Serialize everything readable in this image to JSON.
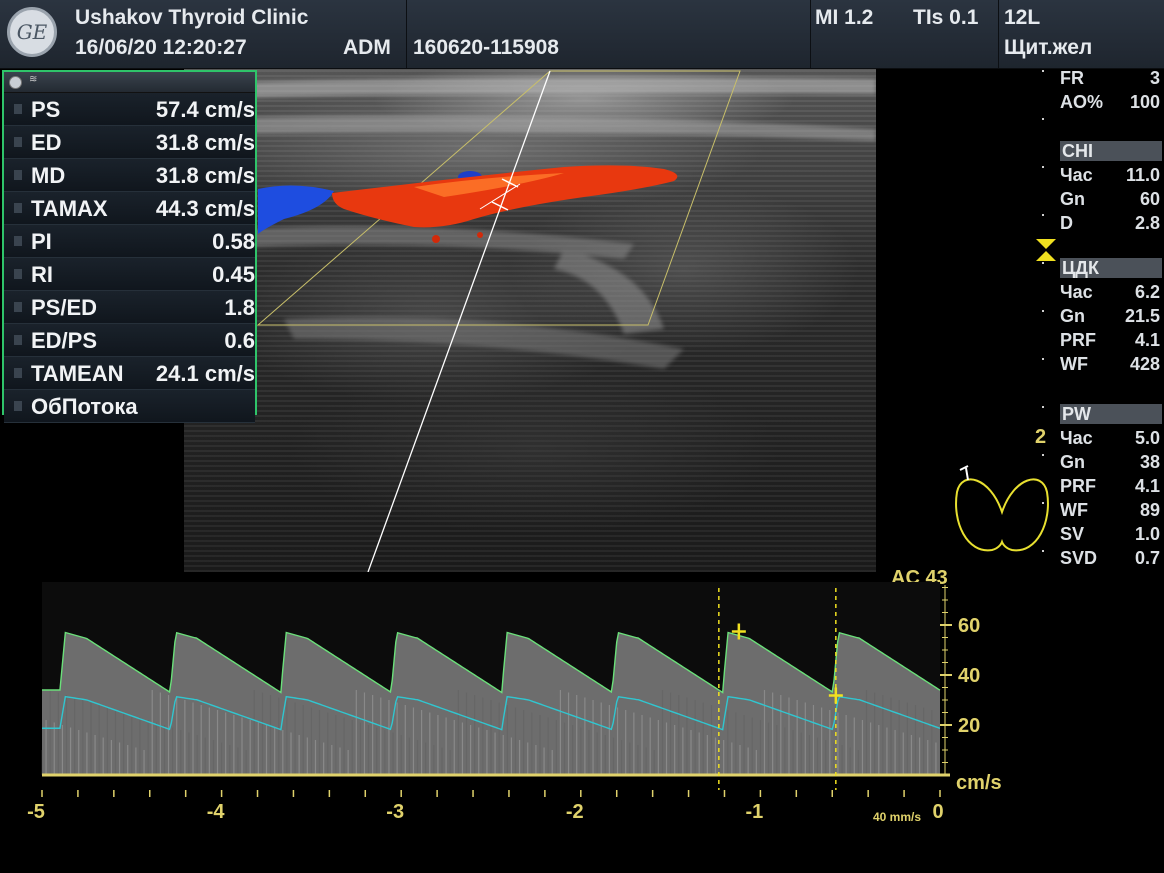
{
  "header": {
    "clinic": "Ushakov Thyroid Clinic",
    "datetime": "16/06/20 12:20:27",
    "operator": "ADM",
    "exam_id": "160620-115908",
    "mi": "MI 1.2",
    "tis": "TIs 0.1",
    "probe": "12L",
    "preset": "Щит.жел",
    "logo_text": "GE"
  },
  "measurements": [
    {
      "label": "PS",
      "value": "57.4 cm/s"
    },
    {
      "label": "ED",
      "value": "31.8 cm/s"
    },
    {
      "label": "MD",
      "value": "31.8 cm/s"
    },
    {
      "label": "TAMAX",
      "value": "44.3 cm/s"
    },
    {
      "label": "PI",
      "value": "0.58"
    },
    {
      "label": "RI",
      "value": "0.45"
    },
    {
      "label": "PS/ED",
      "value": "1.8"
    },
    {
      "label": "ED/PS",
      "value": "0.6"
    },
    {
      "label": "TAMEAN",
      "value": "24.1 cm/s"
    },
    {
      "label": "ОбПотока",
      "value": ""
    }
  ],
  "params": {
    "top": [
      {
        "k": "FR",
        "v": "3"
      },
      {
        "k": "AO%",
        "v": "100"
      }
    ],
    "chi": {
      "title": "CHI",
      "rows": [
        {
          "k": "Час",
          "v": "11.0"
        },
        {
          "k": "Gn",
          "v": "60"
        },
        {
          "k": "D",
          "v": "2.8"
        }
      ]
    },
    "cdk": {
      "title": "ЦДК",
      "rows": [
        {
          "k": "Час",
          "v": "6.2"
        },
        {
          "k": "Gn",
          "v": "21.5"
        },
        {
          "k": "PRF",
          "v": "4.1"
        },
        {
          "k": "WF",
          "v": "428"
        }
      ]
    },
    "pw": {
      "title": "PW",
      "rows": [
        {
          "k": "Час",
          "v": "5.0"
        },
        {
          "k": "Gn",
          "v": "38"
        },
        {
          "k": "PRF",
          "v": "4.1"
        },
        {
          "k": "WF",
          "v": "89"
        },
        {
          "k": "SV",
          "v": "1.0"
        },
        {
          "k": "SVD",
          "v": "0.7"
        }
      ]
    },
    "depth_marker": "2"
  },
  "doppler": {
    "ac_label": "AC 43",
    "unit": "cm/s",
    "sweep": "40 mm/s",
    "y_ticks": [
      "60",
      "40",
      "20"
    ],
    "y_values": [
      60,
      40,
      20
    ],
    "x_ticks": [
      "-5",
      "-4",
      "-3",
      "-2",
      "-1",
      "0"
    ],
    "x_values": [
      -5,
      -4,
      -3,
      -2,
      -1,
      0
    ],
    "ps_cursor_time": -1.12,
    "ed_cursor_time": -0.58,
    "ps_velocity": 57.4,
    "ed_velocity": 31.8
  },
  "colors": {
    "frame": "#2fc46a",
    "yellow": "#e0d26b",
    "envelope": "#6be07a",
    "mean": "#30c6d0",
    "flow_red": "#e8380f",
    "flow_blue": "#1e4de0"
  }
}
